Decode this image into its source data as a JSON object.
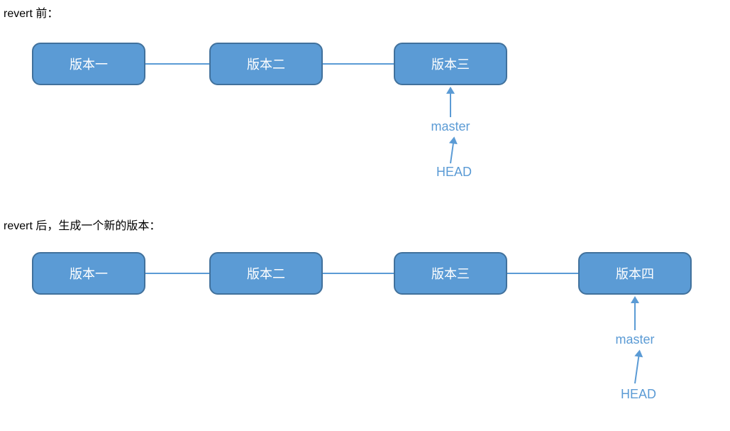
{
  "diagram": {
    "before": {
      "title": "revert 前：",
      "commits": [
        "版本一",
        "版本二",
        "版本三"
      ],
      "branch_label": "master",
      "head_label": "HEAD"
    },
    "after": {
      "title": "revert 后，生成一个新的版本：",
      "commits": [
        "版本一",
        "版本二",
        "版本三",
        "版本四"
      ],
      "branch_label": "master",
      "head_label": "HEAD"
    }
  }
}
